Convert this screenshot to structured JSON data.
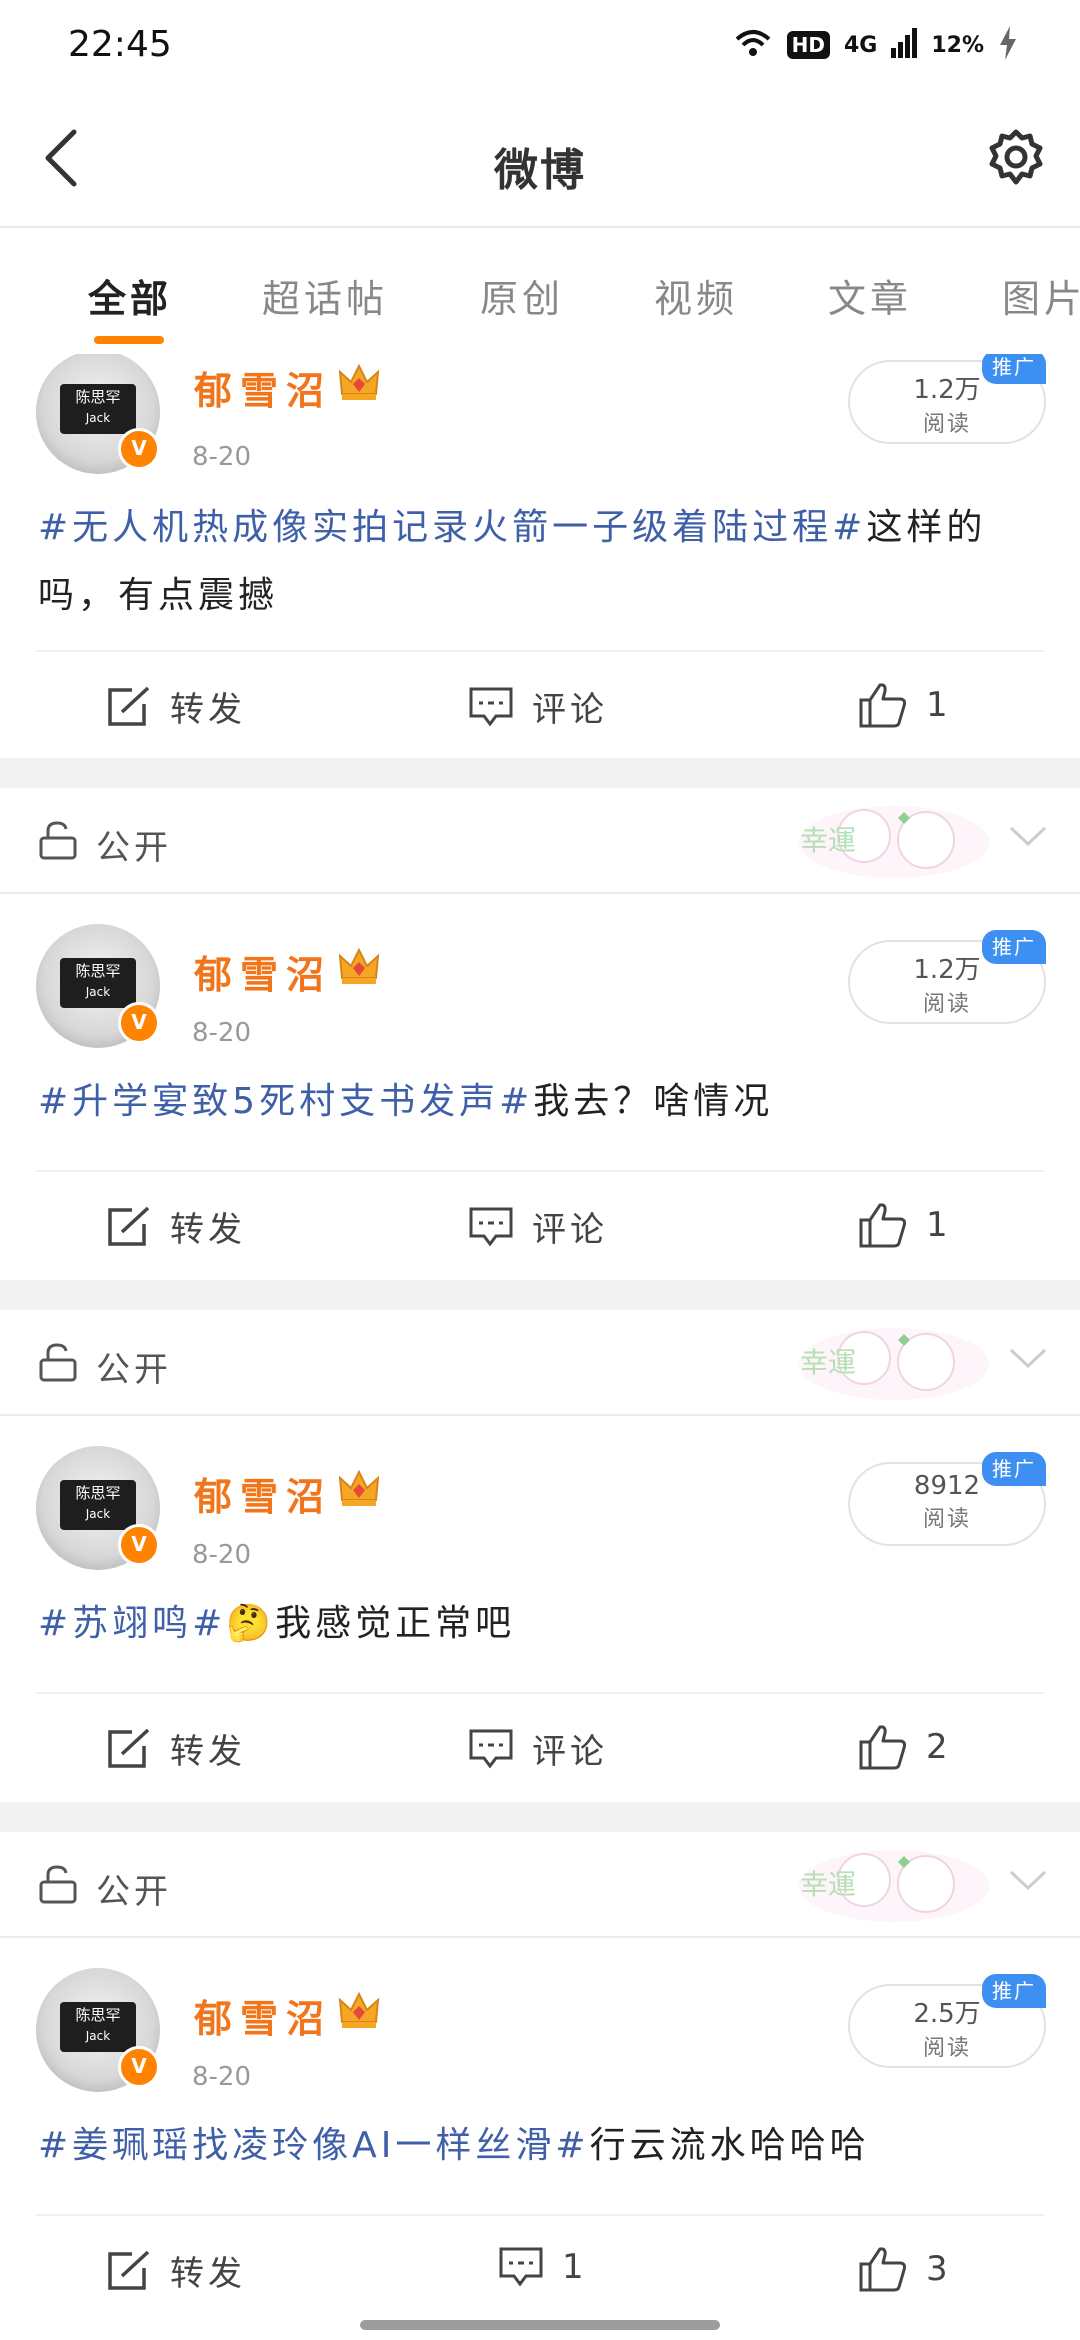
{
  "status_bar": {
    "time": "22:45",
    "network": "4G",
    "hd": "HD",
    "battery": "12%"
  },
  "nav": {
    "title": "微博"
  },
  "tabs": [
    {
      "label": "全部",
      "active": true
    },
    {
      "label": "超话帖"
    },
    {
      "label": "原创"
    },
    {
      "label": "视频"
    },
    {
      "label": "文章"
    },
    {
      "label": "图片"
    }
  ],
  "visibility_label": "公开",
  "deco_text": "幸運",
  "promo_label": "推广",
  "reads_label": "阅读",
  "posts": [
    {
      "user": "郁雪沼",
      "avatar_text": "陈思罕",
      "avatar_sub": "Jack",
      "date": "8-20",
      "reads": "1.2万",
      "tag": "#无人机热成像实拍记录火箭一子级着陆过程#",
      "text": "这样的吗，有点震撼",
      "repost_label": "转发",
      "comment_label": "评论",
      "likes": "1"
    },
    {
      "user": "郁雪沼",
      "avatar_text": "陈思罕",
      "avatar_sub": "Jack",
      "date": "8-20",
      "reads": "1.2万",
      "tag": "#升学宴致5死村支书发声#",
      "text": "我去？啥情况",
      "repost_label": "转发",
      "comment_label": "评论",
      "likes": "1"
    },
    {
      "user": "郁雪沼",
      "avatar_text": "陈思罕",
      "avatar_sub": "Jack",
      "date": "8-20",
      "reads": "8912",
      "tag": "#苏翊鸣#",
      "emoji": "🤔",
      "text": "我感觉正常吧",
      "repost_label": "转发",
      "comment_label": "评论",
      "likes": "2"
    },
    {
      "user": "郁雪沼",
      "avatar_text": "陈思罕",
      "avatar_sub": "Jack",
      "date": "8-20",
      "reads": "2.5万",
      "tag": "#姜珮瑶找凌玲像AI一样丝滑#",
      "text": "行云流水哈哈哈",
      "repost_label": "转发",
      "comments": "1",
      "likes": "3"
    }
  ],
  "colors": {
    "accent": "#ff8200",
    "username": "#f0751b",
    "hashtag": "#3f5fa8",
    "promo": "#3d8ff2"
  }
}
